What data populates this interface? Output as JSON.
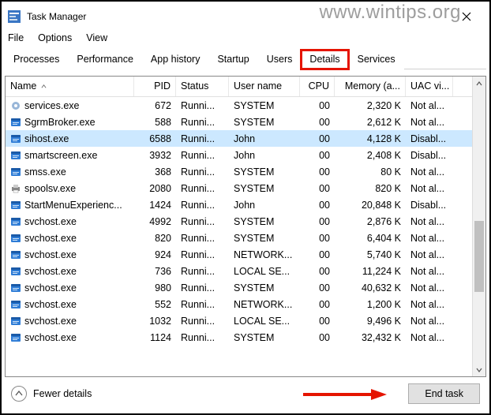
{
  "watermark": "www.wintips.org",
  "window": {
    "title": "Task Manager"
  },
  "menu": {
    "file": "File",
    "options": "Options",
    "view": "View"
  },
  "tabs": {
    "processes": "Processes",
    "performance": "Performance",
    "app_history": "App history",
    "startup": "Startup",
    "users": "Users",
    "details": "Details",
    "services": "Services"
  },
  "columns": {
    "name": "Name",
    "pid": "PID",
    "status": "Status",
    "user": "User name",
    "cpu": "CPU",
    "memory": "Memory (a...",
    "uac": "UAC vi..."
  },
  "rows": [
    {
      "name": "services.exe",
      "pid": "672",
      "status": "Runni...",
      "user": "SYSTEM",
      "cpu": "00",
      "mem": "2,320 K",
      "uac": "Not al...",
      "icon": "gear",
      "selected": false
    },
    {
      "name": "SgrmBroker.exe",
      "pid": "588",
      "status": "Runni...",
      "user": "SYSTEM",
      "cpu": "00",
      "mem": "2,612 K",
      "uac": "Not al...",
      "icon": "app",
      "selected": false
    },
    {
      "name": "sihost.exe",
      "pid": "6588",
      "status": "Runni...",
      "user": "John",
      "cpu": "00",
      "mem": "4,128 K",
      "uac": "Disabl...",
      "icon": "app",
      "selected": true
    },
    {
      "name": "smartscreen.exe",
      "pid": "3932",
      "status": "Runni...",
      "user": "John",
      "cpu": "00",
      "mem": "2,408 K",
      "uac": "Disabl...",
      "icon": "app",
      "selected": false
    },
    {
      "name": "smss.exe",
      "pid": "368",
      "status": "Runni...",
      "user": "SYSTEM",
      "cpu": "00",
      "mem": "80 K",
      "uac": "Not al...",
      "icon": "app",
      "selected": false
    },
    {
      "name": "spoolsv.exe",
      "pid": "2080",
      "status": "Runni...",
      "user": "SYSTEM",
      "cpu": "00",
      "mem": "820 K",
      "uac": "Not al...",
      "icon": "printer",
      "selected": false
    },
    {
      "name": "StartMenuExperienc...",
      "pid": "1424",
      "status": "Runni...",
      "user": "John",
      "cpu": "00",
      "mem": "20,848 K",
      "uac": "Disabl...",
      "icon": "app",
      "selected": false
    },
    {
      "name": "svchost.exe",
      "pid": "4992",
      "status": "Runni...",
      "user": "SYSTEM",
      "cpu": "00",
      "mem": "2,876 K",
      "uac": "Not al...",
      "icon": "app",
      "selected": false
    },
    {
      "name": "svchost.exe",
      "pid": "820",
      "status": "Runni...",
      "user": "SYSTEM",
      "cpu": "00",
      "mem": "6,404 K",
      "uac": "Not al...",
      "icon": "app",
      "selected": false
    },
    {
      "name": "svchost.exe",
      "pid": "924",
      "status": "Runni...",
      "user": "NETWORK...",
      "cpu": "00",
      "mem": "5,740 K",
      "uac": "Not al...",
      "icon": "app",
      "selected": false
    },
    {
      "name": "svchost.exe",
      "pid": "736",
      "status": "Runni...",
      "user": "LOCAL SE...",
      "cpu": "00",
      "mem": "11,224 K",
      "uac": "Not al...",
      "icon": "app",
      "selected": false
    },
    {
      "name": "svchost.exe",
      "pid": "980",
      "status": "Runni...",
      "user": "SYSTEM",
      "cpu": "00",
      "mem": "40,632 K",
      "uac": "Not al...",
      "icon": "app",
      "selected": false
    },
    {
      "name": "svchost.exe",
      "pid": "552",
      "status": "Runni...",
      "user": "NETWORK...",
      "cpu": "00",
      "mem": "1,200 K",
      "uac": "Not al...",
      "icon": "app",
      "selected": false
    },
    {
      "name": "svchost.exe",
      "pid": "1032",
      "status": "Runni...",
      "user": "LOCAL SE...",
      "cpu": "00",
      "mem": "9,496 K",
      "uac": "Not al...",
      "icon": "app",
      "selected": false
    },
    {
      "name": "svchost.exe",
      "pid": "1124",
      "status": "Runni...",
      "user": "SYSTEM",
      "cpu": "00",
      "mem": "32,432 K",
      "uac": "Not al...",
      "icon": "app",
      "selected": false
    }
  ],
  "footer": {
    "fewer": "Fewer details",
    "end_task": "End task"
  }
}
